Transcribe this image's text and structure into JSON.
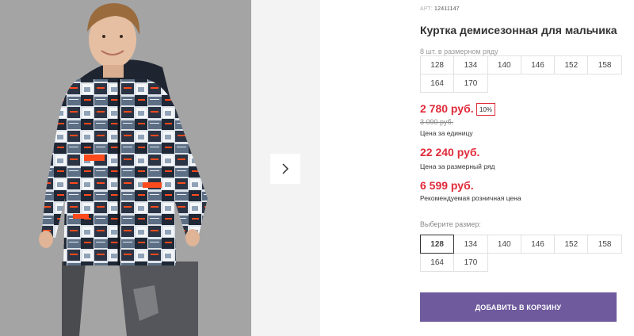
{
  "product": {
    "article_label": "АРТ:",
    "article_number": "12411147",
    "title": "Куртка демисезонная для мальчика",
    "image_alt": "Мальчик в демисезонной куртке"
  },
  "pack": {
    "note": "8 шт. в размерном ряду",
    "sizes": [
      "128",
      "134",
      "140",
      "146",
      "152",
      "158",
      "164",
      "170"
    ]
  },
  "pricing": {
    "unit_price": "2 780 руб.",
    "discount": "10%",
    "old_price": "3 090 руб.",
    "unit_caption": "Цена за единицу",
    "pack_price": "22 240 руб.",
    "pack_caption": "Цена за размерный ряд",
    "rrp_price": "6 599 руб.",
    "rrp_caption": "Рекомендуемая розничная цена"
  },
  "size_select": {
    "label": "Выберите размер:",
    "selected": "128",
    "sizes": [
      "128",
      "134",
      "140",
      "146",
      "152",
      "158",
      "164",
      "170"
    ]
  },
  "actions": {
    "add_to_cart": "ДОБАВИТЬ В КОРЗИНУ"
  },
  "colors": {
    "price": "#e02b3a",
    "button": "#6e5a9d",
    "photo_background": "#a4a4a5"
  },
  "icons": {
    "next": "chevron-right-icon"
  }
}
